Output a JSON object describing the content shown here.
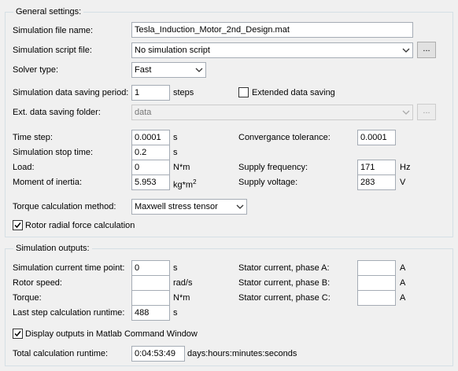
{
  "general": {
    "title": "General settings:",
    "sim_file_label": "Simulation file name:",
    "sim_file_value": "Tesla_Induction_Motor_2nd_Design.mat",
    "script_file_label": "Simulation script file:",
    "script_file_value": "No simulation script",
    "browse_label": "...",
    "solver_label": "Solver type:",
    "solver_value": "Fast",
    "saving_period_label": "Simulation data saving period:",
    "saving_period_value": "1",
    "saving_period_unit": "steps",
    "extended_saving_label": "Extended data saving",
    "extended_saving_checked": false,
    "ext_folder_label": "Ext. data saving folder:",
    "ext_folder_value": "data",
    "time_step_label": "Time step:",
    "time_step_value": "0.0001",
    "time_step_unit": "s",
    "stop_time_label": "Simulation stop time:",
    "stop_time_value": "0.2",
    "stop_time_unit": "s",
    "load_label": "Load:",
    "load_value": "0",
    "load_unit": "N*m",
    "inertia_label": "Moment of inertia:",
    "inertia_value": "5.953",
    "inertia_unit_base": "kg*m",
    "inertia_unit_sup": "2",
    "tolerance_label": "Convergance tolerance:",
    "tolerance_value": "0.0001",
    "supply_freq_label": "Supply frequency:",
    "supply_freq_value": "171",
    "supply_freq_unit": "Hz",
    "supply_volt_label": "Supply voltage:",
    "supply_volt_value": "283",
    "supply_volt_unit": "V",
    "torque_method_label": "Torque calculation method:",
    "torque_method_value": "Maxwell stress tensor",
    "radial_force_label": "Rotor radial force calculation",
    "radial_force_checked": true
  },
  "outputs": {
    "title": "Simulation outputs:",
    "current_time_label": "Simulation current time point:",
    "current_time_value": "0",
    "current_time_unit": "s",
    "rotor_speed_label": "Rotor speed:",
    "rotor_speed_value": "",
    "rotor_speed_unit": "rad/s",
    "torque_label": "Torque:",
    "torque_value": "",
    "torque_unit": "N*m",
    "last_step_label": "Last step calculation runtime:",
    "last_step_value": "488",
    "last_step_unit": "s",
    "phase_a_label": "Stator current, phase A:",
    "phase_a_value": "",
    "phase_a_unit": "A",
    "phase_b_label": "Stator current, phase B:",
    "phase_b_value": "",
    "phase_b_unit": "A",
    "phase_c_label": "Stator current, phase C:",
    "phase_c_value": "",
    "phase_c_unit": "A",
    "display_cmd_label": "Display outputs in Matlab Command Window",
    "display_cmd_checked": true,
    "total_runtime_label": "Total calculation runtime:",
    "total_runtime_value": "0:04:53:49",
    "total_runtime_unit": "days:hours:minutes:seconds"
  }
}
